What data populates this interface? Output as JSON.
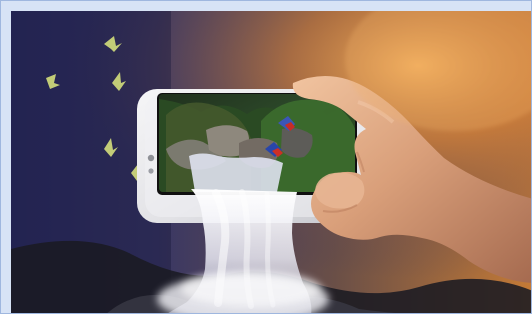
{
  "image": {
    "subject": "hand-holding-phone-with-waterfall",
    "palette": {
      "left_sky": "#2c2d62",
      "mid_sky": "#393764",
      "right_glow": "#c47a36",
      "skin": "#d9a37f",
      "phone_body": "#e9e7ea",
      "water": "#f2f2f8",
      "foliage": "#3b6d2f"
    },
    "icon_names": [
      "bird-icon",
      "parrot-icon",
      "waterfall-icon",
      "hand-icon",
      "smartphone-icon"
    ]
  }
}
